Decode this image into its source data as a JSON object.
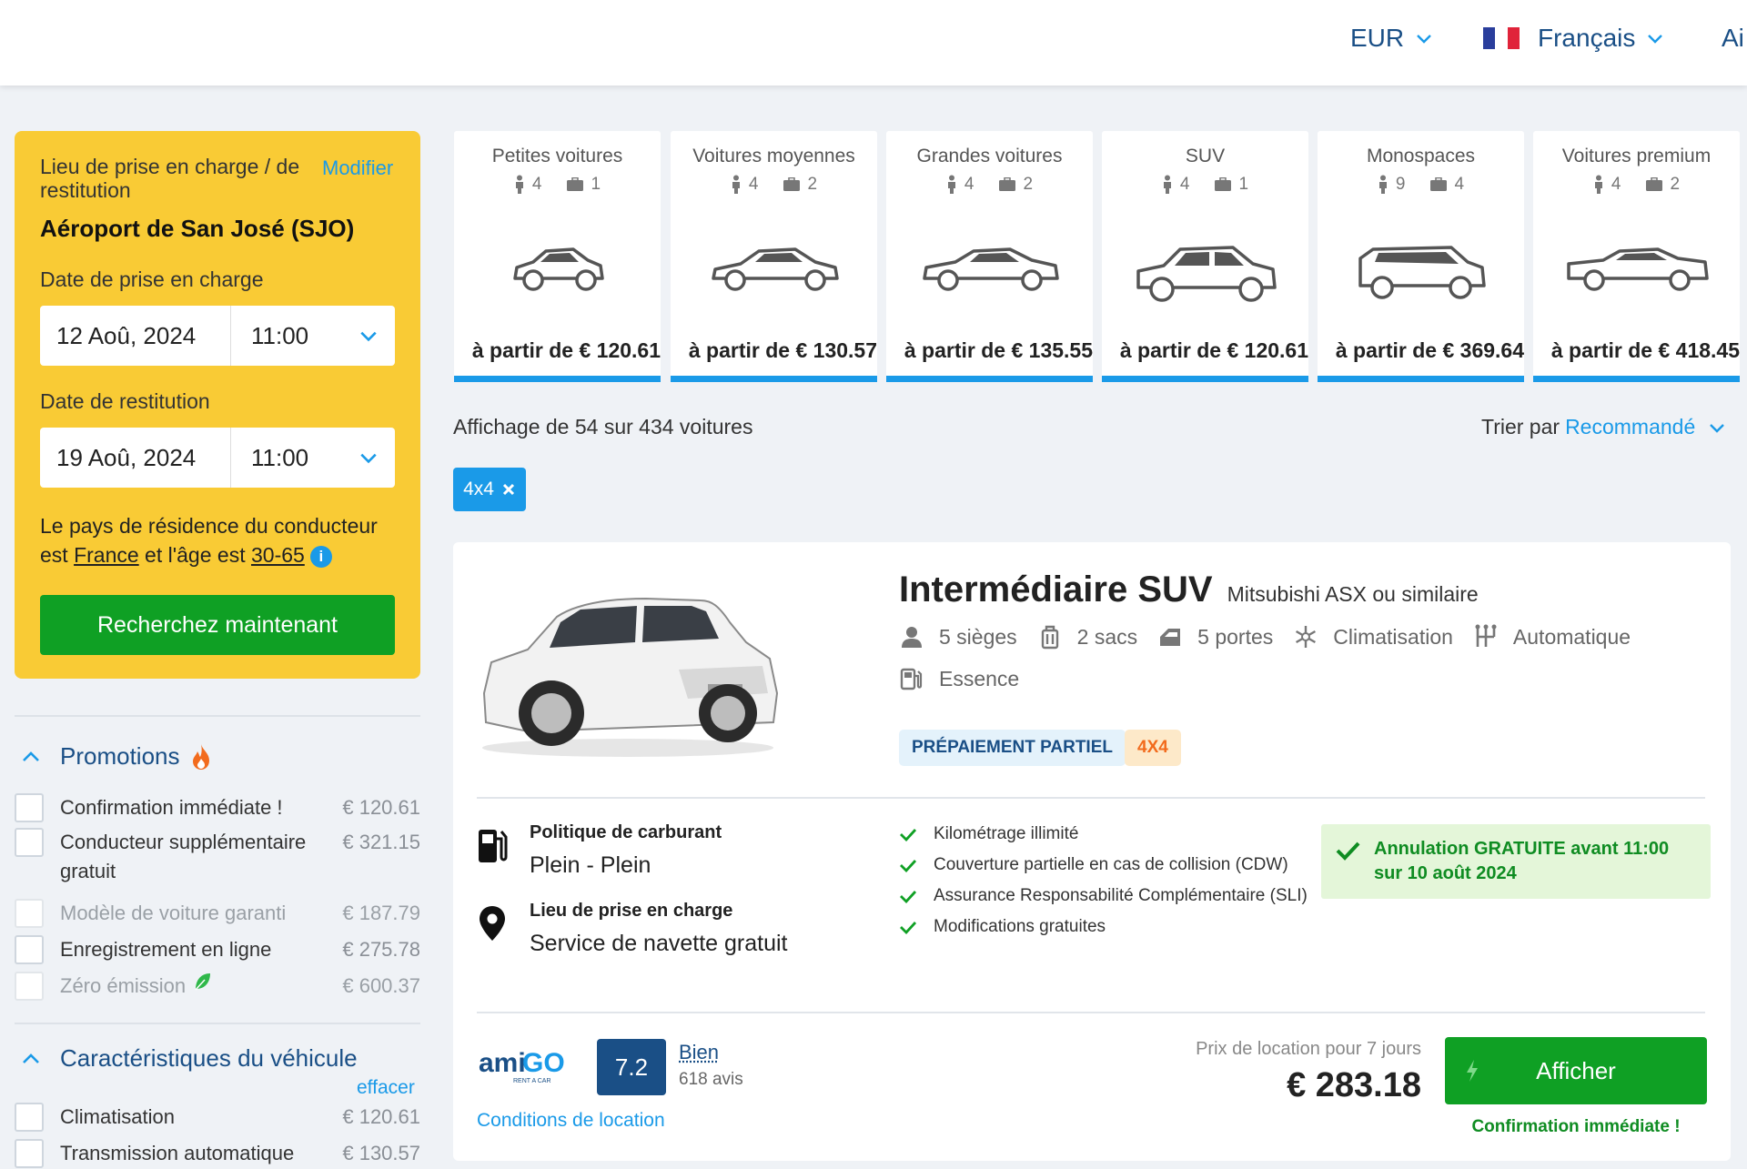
{
  "header": {
    "currency": "EUR",
    "language": "Français",
    "help_partial": "Ai"
  },
  "search": {
    "location_label": "Lieu de prise en charge / de restitution",
    "modify": "Modifier",
    "location": "Aéroport de San José (SJO)",
    "pickup_label": "Date de prise en charge",
    "pickup_date": "12 Aoû, 2024",
    "pickup_time": "11:00",
    "return_label": "Date de restitution",
    "return_date": "19 Aoû, 2024",
    "return_time": "11:00",
    "residence_pre": "Le pays de résidence du conducteur est ",
    "residence_country": "France",
    "residence_mid": " et l'âge est ",
    "residence_age": "30-65",
    "search_button": "Recherchez maintenant"
  },
  "filters": {
    "promotions": {
      "title": "Promotions",
      "items": [
        {
          "label": "Confirmation immédiate !",
          "price": "€ 120.61",
          "enabled": true
        },
        {
          "label": "Conducteur supplémentaire gratuit",
          "price": "€ 321.15",
          "enabled": true
        },
        {
          "label": "Modèle de voiture garanti",
          "price": "€ 187.79",
          "enabled": false
        },
        {
          "label": "Enregistrement en ligne",
          "price": "€ 275.78",
          "enabled": true
        },
        {
          "label": "Zéro émission",
          "price": "€ 600.37",
          "enabled": false
        }
      ]
    },
    "vehicle": {
      "title": "Caractéristiques du véhicule",
      "clear": "effacer",
      "items": [
        {
          "label": "Climatisation",
          "price": "€ 120.61"
        },
        {
          "label": "Transmission automatique",
          "price": "€ 130.57"
        }
      ]
    }
  },
  "categories": [
    {
      "name": "Petites voitures",
      "seats": "4",
      "bags": "1",
      "price": "à partir de € 120.61"
    },
    {
      "name": "Voitures moyennes",
      "seats": "4",
      "bags": "2",
      "price": "à partir de € 130.57"
    },
    {
      "name": "Grandes voitures",
      "seats": "4",
      "bags": "2",
      "price": "à partir de € 135.55"
    },
    {
      "name": "SUV",
      "seats": "4",
      "bags": "1",
      "price": "à partir de € 120.61"
    },
    {
      "name": "Monospaces",
      "seats": "9",
      "bags": "4",
      "price": "à partir de € 369.64"
    },
    {
      "name": "Voitures premium",
      "seats": "4",
      "bags": "2",
      "price": "à partir de € 418.45"
    }
  ],
  "results": {
    "showing": "Affichage de 54 sur 434 voitures",
    "sort_label": "Trier par",
    "sort_value": "Recommandé",
    "active_filter": "4x4"
  },
  "offer": {
    "class": "Intermédiaire SUV",
    "model": "Mitsubishi ASX ou similaire",
    "features": {
      "seats": "5 sièges",
      "bags": "2 sacs",
      "doors": "5 portes",
      "ac": "Climatisation",
      "transmission": "Automatique",
      "fuel": "Essence"
    },
    "tags": [
      "PRÉPAIEMENT PARTIEL",
      "4X4"
    ],
    "fuel_policy_label": "Politique de carburant",
    "fuel_policy": "Plein - Plein",
    "pickup_label": "Lieu de prise en charge",
    "pickup": "Service de navette gratuit",
    "included": [
      "Kilométrage illimité",
      "Couverture partielle en cas de collision (CDW)",
      "Assurance Responsabilité Complémentaire (SLI)",
      "Modifications gratuites"
    ],
    "cancellation": "Annulation GRATUITE avant 11:00 sur 10 août 2024",
    "supplier_logo": "amiGO RENT A CAR",
    "score": "7.2",
    "rating_word": "Bien",
    "reviews": "618 avis",
    "conditions": "Conditions de location",
    "price_label": "Prix de location pour 7 jours",
    "price": "€ 283.18",
    "button": "Afficher",
    "confirmation": "Confirmation immédiate !"
  },
  "colors": {
    "accent": "#1a9ae8",
    "navy": "#1a4f86",
    "search_panel": "#f9cb35",
    "green": "#0fa024"
  }
}
